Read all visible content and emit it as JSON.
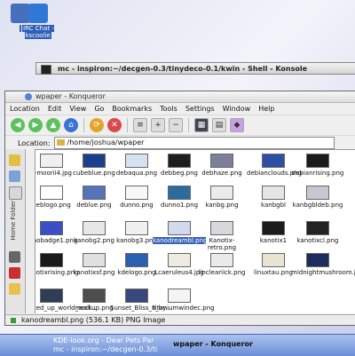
{
  "desktop": {
    "icons": [
      {
        "label": ""
      },
      {
        "label": "IRC Chat - kscoolie",
        "color": "#2f78d4"
      }
    ]
  },
  "konsole": {
    "title": "mc - inspiron:~/decgen-0.3/tinydeco-0.1/kwin - Shell - Konsole"
  },
  "window": {
    "title": "wpaper - Konqueror",
    "menu": [
      "Location",
      "Edit",
      "View",
      "Go",
      "Bookmarks",
      "Tools",
      "Settings",
      "Window",
      "Help"
    ],
    "location_label": "Location:",
    "location_value": "/home/joshua/wpaper",
    "sidebar_tab": "Home Folder",
    "status": "kanodreambl.png (536.1 KB)  PNG Image"
  },
  "files": [
    {
      "name": "c-moorii4.jpg",
      "color": "#f0f0f0"
    },
    {
      "name": "cubeblue.png",
      "color": "#1b3f8c"
    },
    {
      "name": "debaqua.png",
      "color": "#d4e3f1"
    },
    {
      "name": "debbeg.png",
      "color": "#1d1d1d"
    },
    {
      "name": "debhaze.png",
      "color": "#7c7f9a"
    },
    {
      "name": "debianclouds.png",
      "color": "#2e4fa5"
    },
    {
      "name": "debianrising.png",
      "color": "#1a1a1a"
    },
    {
      "name": "deblogo.png",
      "color": "#ffffff"
    },
    {
      "name": "deblue.png",
      "color": "#5673b8"
    },
    {
      "name": "dunno.png",
      "color": "#f7f7f7"
    },
    {
      "name": "dunno1.png",
      "color": "#2c6c9c"
    },
    {
      "name": "kanbg.png",
      "color": "#ebebeb"
    },
    {
      "name": "kanbgbl",
      "color": "#e5e5e5"
    },
    {
      "name": "kanbgbldeb.png",
      "color": "#c7c7d2"
    },
    {
      "name": "kanobadge1.png",
      "color": "#3b4ec8"
    },
    {
      "name": "kanobg2.png",
      "color": "#e7e7e7"
    },
    {
      "name": "kanobg3.png",
      "color": "#f0f0f0"
    },
    {
      "name": "kanodreambl.png",
      "color": "#d2d9ee"
    },
    {
      "name": "Kanotix-retro.png",
      "color": "#d8d8dc"
    },
    {
      "name": "kanotix1",
      "color": "#1b1b1b"
    },
    {
      "name": "kanotixcl.png",
      "color": "#222222"
    },
    {
      "name": "kanotixrising.png",
      "color": "#1a1a1a"
    },
    {
      "name": "kanotixsf.png",
      "color": "#e0e0e0"
    },
    {
      "name": "kdelogo.png",
      "color": "#2d5fb0"
    },
    {
      "name": "Lcaeruleus4.jpg",
      "color": "#f0ebe0"
    },
    {
      "name": "lincleariick.png",
      "color": "#eaeaea"
    },
    {
      "name": "linuxtau.png",
      "color": "#e9e4d2"
    },
    {
      "name": "midnightmushroom.jpg",
      "color": "#1c2d5c"
    },
    {
      "name": "mixed_up_world_wall...",
      "color": "#2f3e57"
    },
    {
      "name": "mockup.png",
      "color": "#4d4d4d"
    },
    {
      "name": "Sunset_Bliss_II_by...",
      "color": "#3a477a"
    },
    {
      "name": "titaniumwindec.png",
      "color": "#f4f4f4"
    }
  ],
  "taskbar": [
    {
      "label": "KDE-look.org - Dear Pets Par"
    },
    {
      "label": "mc - inspiron:~/decgen-0.3/ti"
    },
    {
      "label": "wpaper - Konqueror"
    }
  ]
}
